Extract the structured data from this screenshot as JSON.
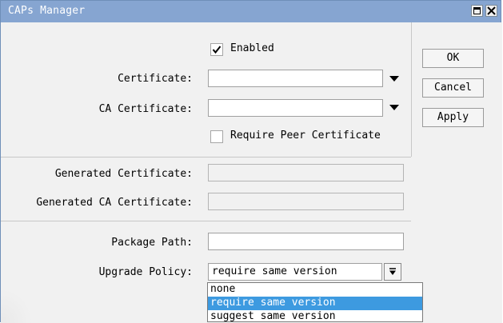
{
  "window": {
    "title": "CAPs Manager",
    "titlebar_color": "#86a5d1"
  },
  "icons": {
    "maximize": "maximize-icon",
    "close": "close-icon",
    "checkmark": "checkmark-icon",
    "dropdown": "dropdown-triangle-icon"
  },
  "form": {
    "enabled": {
      "label": "Enabled",
      "checked": true
    },
    "certificate": {
      "label": "Certificate:",
      "value": ""
    },
    "ca_certificate": {
      "label": "CA Certificate:",
      "value": ""
    },
    "require_peer_certificate": {
      "label": "Require Peer Certificate",
      "checked": false
    },
    "generated_certificate": {
      "label": "Generated Certificate:",
      "value": ""
    },
    "generated_ca_certificate": {
      "label": "Generated CA Certificate:",
      "value": ""
    },
    "package_path": {
      "label": "Package Path:",
      "value": ""
    },
    "upgrade_policy": {
      "label": "Upgrade Policy:",
      "value": "require same version",
      "options": [
        "none",
        "require same version",
        "suggest same version"
      ],
      "selected_index": 1
    }
  },
  "buttons": {
    "ok": "OK",
    "cancel": "Cancel",
    "apply": "Apply"
  }
}
